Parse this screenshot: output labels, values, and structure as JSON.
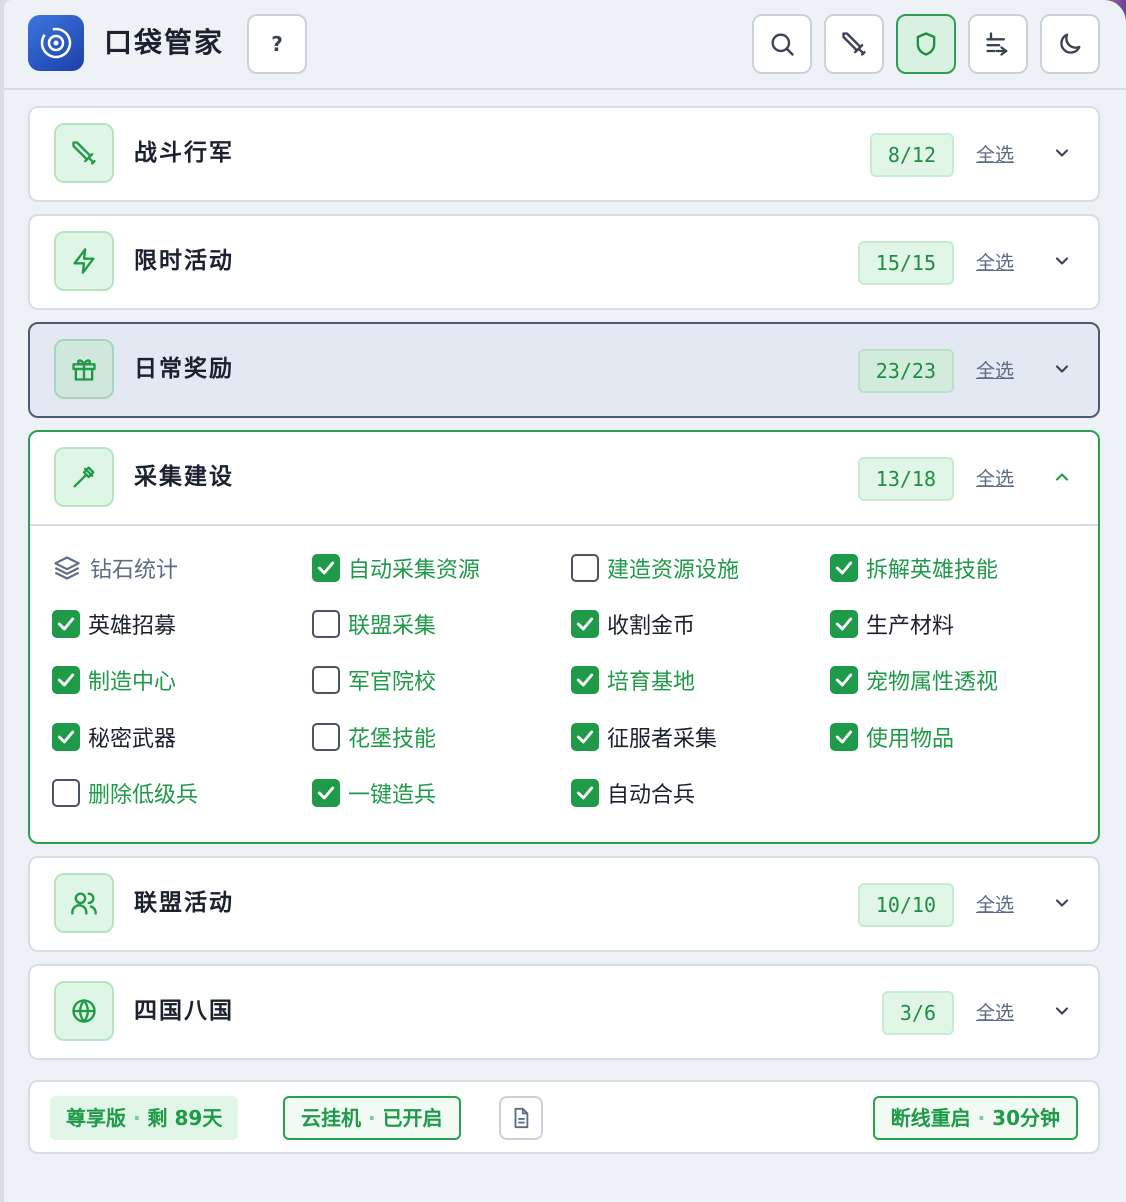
{
  "app": {
    "title": "口袋管家",
    "help_label": "?"
  },
  "toolbar": {
    "buttons": [
      {
        "icon": "search-icon"
      },
      {
        "icon": "sword-icon"
      },
      {
        "icon": "shield-icon",
        "active": true
      },
      {
        "icon": "sort-icon"
      },
      {
        "icon": "moon-icon"
      }
    ]
  },
  "select_all_label": "全选",
  "sections": [
    {
      "title": "战斗行军",
      "count": "8/12",
      "icon": "sword-icon"
    },
    {
      "title": "限时活动",
      "count": "15/15",
      "icon": "lightning-icon"
    },
    {
      "title": "日常奖励",
      "count": "23/23",
      "icon": "gift-icon"
    },
    {
      "title": "采集建设",
      "count": "13/18",
      "icon": "pickaxe-icon",
      "expanded": true
    },
    {
      "title": "联盟活动",
      "count": "10/10",
      "icon": "users-icon"
    },
    {
      "title": "四国八国",
      "count": "3/6",
      "icon": "globe-icon"
    }
  ],
  "options": [
    {
      "label": "钻石统计",
      "type": "info"
    },
    {
      "label": "自动采集资源",
      "checked": true,
      "color": "green"
    },
    {
      "label": "建造资源设施",
      "checked": false,
      "color": "green"
    },
    {
      "label": "拆解英雄技能",
      "checked": true,
      "color": "green"
    },
    {
      "label": "英雄招募",
      "checked": true,
      "color": "dark"
    },
    {
      "label": "联盟采集",
      "checked": false,
      "color": "green"
    },
    {
      "label": "收割金币",
      "checked": true,
      "color": "dark"
    },
    {
      "label": "生产材料",
      "checked": true,
      "color": "dark"
    },
    {
      "label": "制造中心",
      "checked": true,
      "color": "green"
    },
    {
      "label": "军官院校",
      "checked": false,
      "color": "green"
    },
    {
      "label": "培育基地",
      "checked": true,
      "color": "green"
    },
    {
      "label": "宠物属性透视",
      "checked": true,
      "color": "green"
    },
    {
      "label": "秘密武器",
      "checked": true,
      "color": "dark"
    },
    {
      "label": "花堡技能",
      "checked": false,
      "color": "green"
    },
    {
      "label": "征服者采集",
      "checked": true,
      "color": "dark"
    },
    {
      "label": "使用物品",
      "checked": true,
      "color": "green"
    },
    {
      "label": "删除低级兵",
      "checked": false,
      "color": "green"
    },
    {
      "label": "一键造兵",
      "checked": true,
      "color": "green"
    },
    {
      "label": "自动合兵",
      "checked": true,
      "color": "dark"
    }
  ],
  "footer": {
    "vip": {
      "name": "尊享版",
      "sep": "·",
      "remain": "剩 89天"
    },
    "cloud": {
      "name": "云挂机",
      "sep": "·",
      "status": "已开启"
    },
    "reconnect": {
      "name": "断线重启",
      "sep": "·",
      "interval": "30分钟"
    }
  },
  "colors": {
    "accent": "#1f9a48",
    "brand": "#2a5bd7"
  }
}
